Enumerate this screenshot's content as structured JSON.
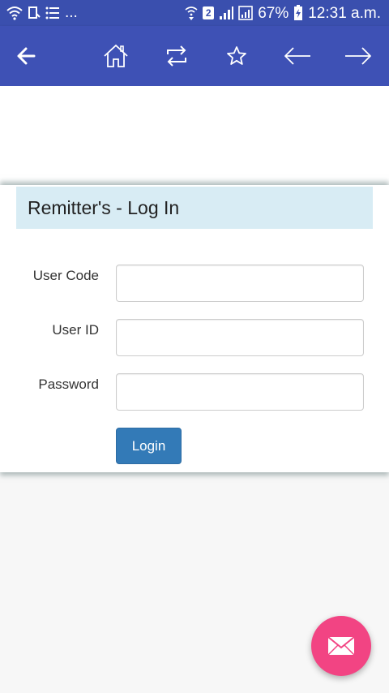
{
  "status_bar": {
    "dots": "...",
    "sim_badge": "2",
    "battery": "67%",
    "time": "12:31 a.m."
  },
  "toolbar": {
    "icons": [
      "back-arrow-icon",
      "home-icon",
      "refresh-icon",
      "star-icon",
      "arrow-left-icon",
      "arrow-right-icon"
    ]
  },
  "login_card": {
    "title": "Remitter's - Log In",
    "fields": {
      "user_code": {
        "label": "User Code",
        "value": ""
      },
      "user_id": {
        "label": "User ID",
        "value": ""
      },
      "password": {
        "label": "Password",
        "value": ""
      }
    },
    "login_label": "Login"
  },
  "colors": {
    "status_bar": "#3a4fae",
    "toolbar": "#3e51b5",
    "header_bg": "#d8ecf4",
    "login_button": "#337ab7",
    "fab": "#f24483"
  }
}
